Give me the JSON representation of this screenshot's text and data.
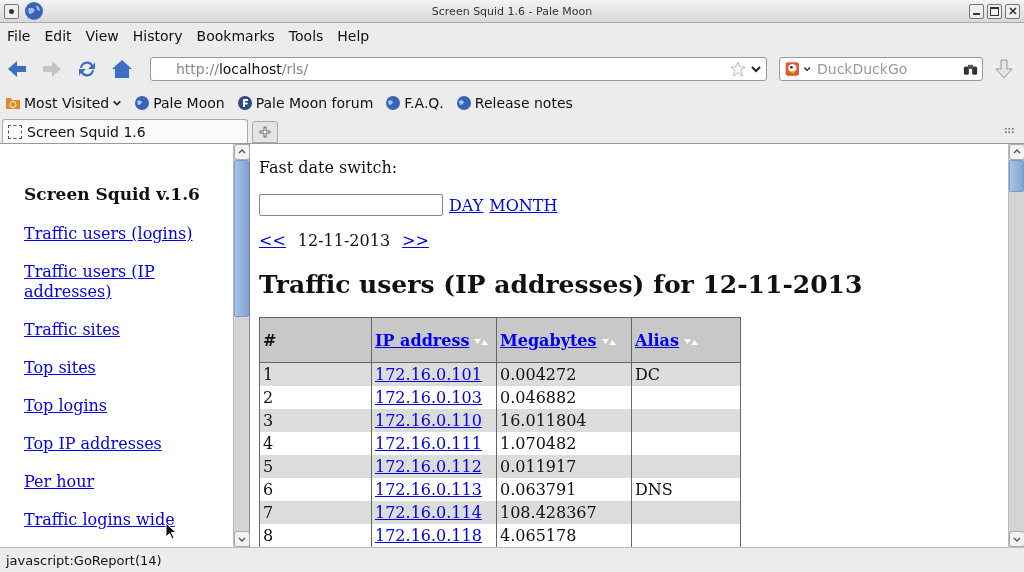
{
  "window": {
    "title": "Screen Squid 1.6 - Pale Moon"
  },
  "menu": [
    "File",
    "Edit",
    "View",
    "History",
    "Bookmarks",
    "Tools",
    "Help"
  ],
  "address": {
    "scheme": "http://",
    "host": "localhost",
    "path": "/rls/"
  },
  "search": {
    "placeholder": "DuckDuckGo"
  },
  "bookmarks": [
    {
      "label": "Most Visited",
      "kind": "folder"
    },
    {
      "label": "Pale Moon",
      "kind": "globe"
    },
    {
      "label": "Pale Moon forum",
      "kind": "forum"
    },
    {
      "label": "F.A.Q.",
      "kind": "globe"
    },
    {
      "label": "Release notes",
      "kind": "globe"
    }
  ],
  "tabs": [
    {
      "label": "Screen Squid 1.6",
      "selected": true
    }
  ],
  "sidebar": {
    "heading": "Screen Squid v.1.6",
    "items": [
      "Traffic users (logins)",
      "Traffic users (IP addresses)",
      "Traffic sites",
      "Top sites",
      "Top logins",
      "Top IP addresses",
      "Per hour",
      "Traffic logins wide"
    ]
  },
  "content": {
    "date_switch_label": "Fast date switch:",
    "day_link": "DAY",
    "month_link": "MONTH",
    "prev": "<<",
    "date": "12-11-2013",
    "next": ">>",
    "heading": "Traffic users (IP addresses) for 12-11-2013"
  },
  "table": {
    "columns": [
      {
        "label": "#",
        "sortable": false
      },
      {
        "label": "IP address",
        "sortable": true
      },
      {
        "label": "Megabytes",
        "sortable": true
      },
      {
        "label": "Alias",
        "sortable": true
      }
    ],
    "rows": [
      [
        "1",
        "172.16.0.101",
        "0.004272",
        "DC"
      ],
      [
        "2",
        "172.16.0.103",
        "0.046882",
        ""
      ],
      [
        "3",
        "172.16.0.110",
        "16.011804",
        ""
      ],
      [
        "4",
        "172.16.0.111",
        "1.070482",
        ""
      ],
      [
        "5",
        "172.16.0.112",
        "0.011917",
        ""
      ],
      [
        "6",
        "172.16.0.113",
        "0.063791",
        "DNS"
      ],
      [
        "7",
        "172.16.0.114",
        "108.428367",
        ""
      ],
      [
        "8",
        "172.16.0.118",
        "4.065178",
        ""
      ]
    ]
  },
  "status_bar": "javascript:GoReport(14)"
}
